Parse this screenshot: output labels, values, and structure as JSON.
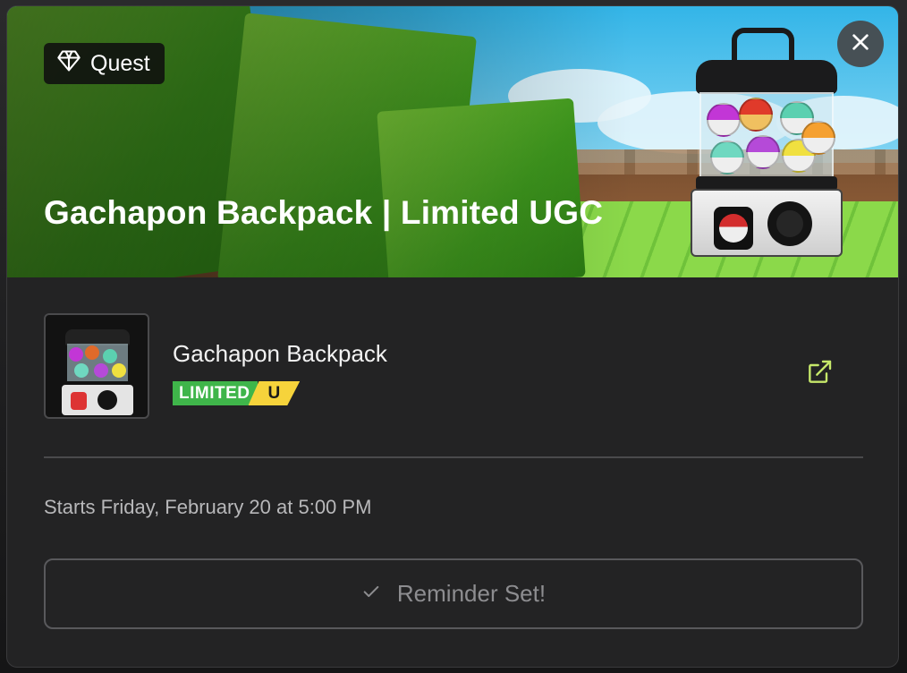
{
  "modal": {
    "badge_label": "Quest",
    "badge_icon": "gem-icon",
    "title": "Gachapon Backpack | Limited UGC",
    "close_icon": "close-icon"
  },
  "item": {
    "name": "Gachapon Backpack",
    "limited_label": "LIMITED",
    "limited_suffix": "U",
    "external_icon": "external-link-icon"
  },
  "schedule": {
    "starts_text": "Starts Friday, February 20 at 5:00 PM"
  },
  "reminder": {
    "label": "Reminder Set!",
    "icon": "check-icon"
  },
  "colors": {
    "modal_bg": "#232324",
    "limited_green": "#3fb54a",
    "limited_yellow": "#f6d33b",
    "accent_link": "#c6e86a"
  }
}
